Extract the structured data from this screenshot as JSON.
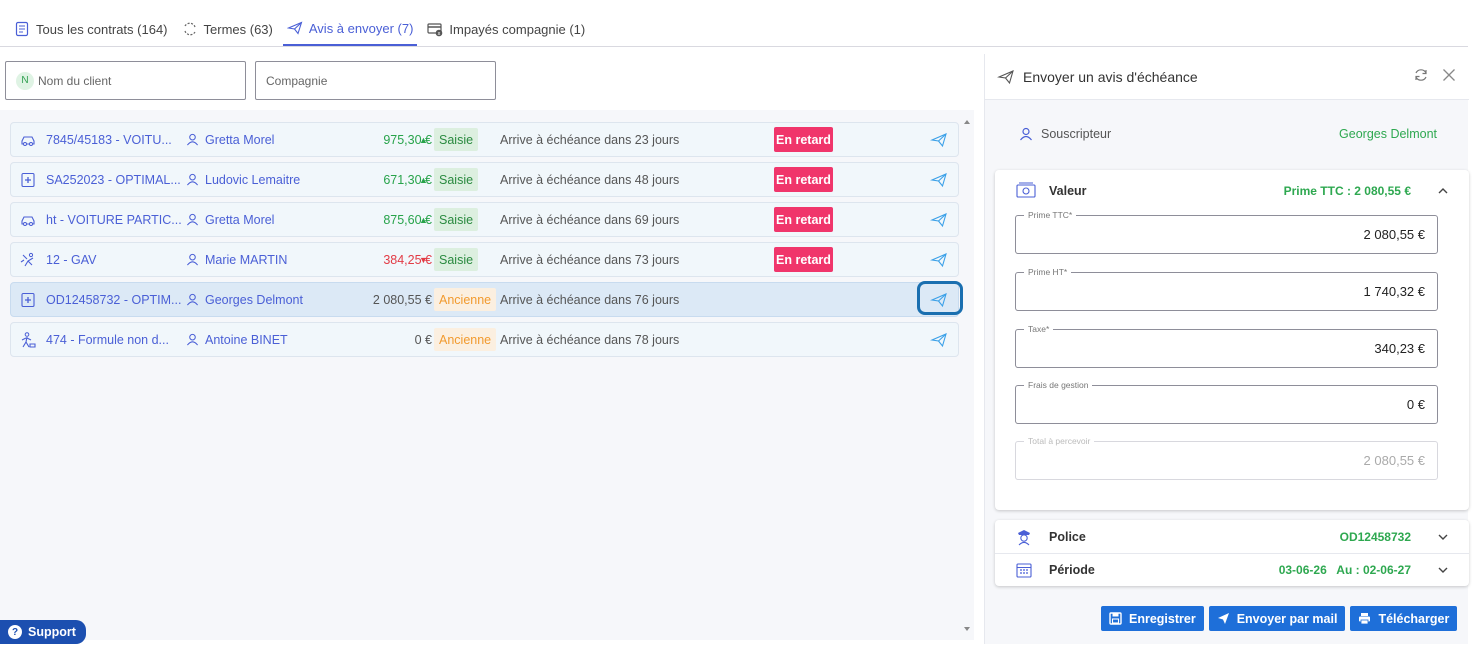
{
  "tabs": [
    {
      "label": "Tous les contrats (164)",
      "icon": "contract-icon"
    },
    {
      "label": "Termes (63)",
      "icon": "refresh-icon"
    },
    {
      "label": "Avis à envoyer (7)",
      "icon": "send-icon"
    },
    {
      "label": "Impayés compagnie (1)",
      "icon": "card-warning-icon"
    }
  ],
  "filters": {
    "client_avatar": "N",
    "client_placeholder": "Nom du client",
    "company_placeholder": "Compagnie"
  },
  "rows": [
    {
      "ref": "7845/45183 - VOITU...",
      "client": "Gretta Morel",
      "amount": "975,30 €",
      "trend": "up",
      "status": "Saisie",
      "due": "Arrive à échéance dans 23 jours",
      "late": "En retard",
      "icon": "car-icon"
    },
    {
      "ref": "SA252023 - OPTIMAL...",
      "client": "Ludovic Lemaitre",
      "amount": "671,30 €",
      "trend": "up",
      "status": "Saisie",
      "due": "Arrive à échéance dans 48 jours",
      "late": "En retard",
      "icon": "health-icon"
    },
    {
      "ref": "ht - VOITURE PARTIC...",
      "client": "Gretta Morel",
      "amount": "875,60 €",
      "trend": "up",
      "status": "Saisie",
      "due": "Arrive à échéance dans 69 jours",
      "late": "En retard",
      "icon": "car-icon"
    },
    {
      "ref": "12 - GAV",
      "client": "Marie MARTIN",
      "amount": "384,25 €",
      "trend": "down",
      "status": "Saisie",
      "due": "Arrive à échéance dans 73 jours",
      "late": "En retard",
      "icon": "accident-icon"
    },
    {
      "ref": "OD12458732 - OPTIM...",
      "client": "Georges Delmont",
      "amount": "2 080,55 €",
      "trend": "",
      "status": "Ancienne",
      "due": "Arrive à échéance dans 76 jours",
      "late": "",
      "icon": "health-icon"
    },
    {
      "ref": "474 - Formule non d...",
      "client": "Antoine BINET",
      "amount": "0 €",
      "trend": "",
      "status": "Ancienne",
      "due": "Arrive à échéance dans 78 jours",
      "late": "",
      "icon": "worker-icon"
    }
  ],
  "support": {
    "label": "Support"
  },
  "panel": {
    "title": "Envoyer un avis d'échéance",
    "subscriber_label": "Souscripteur",
    "subscriber_name": "Georges Delmont",
    "valeur": {
      "title": "Valeur",
      "summary": "Prime TTC : 2 080,55 €",
      "fields": [
        {
          "label": "Prime TTC*",
          "value": "2 080,55 €"
        },
        {
          "label": "Prime HT*",
          "value": "1 740,32 €"
        },
        {
          "label": "Taxe*",
          "value": "340,23 €"
        },
        {
          "label": "Frais de gestion",
          "value": "0 €"
        },
        {
          "label": "Total à percevoir",
          "value": "2 080,55 €"
        }
      ]
    },
    "police": {
      "title": "Police",
      "value": "OD12458732"
    },
    "periode": {
      "title": "Période",
      "value": "03-06-26   Au : 02-06-27"
    },
    "buttons": {
      "save": "Enregistrer",
      "mail": "Envoyer par mail",
      "download": "Télécharger"
    }
  }
}
